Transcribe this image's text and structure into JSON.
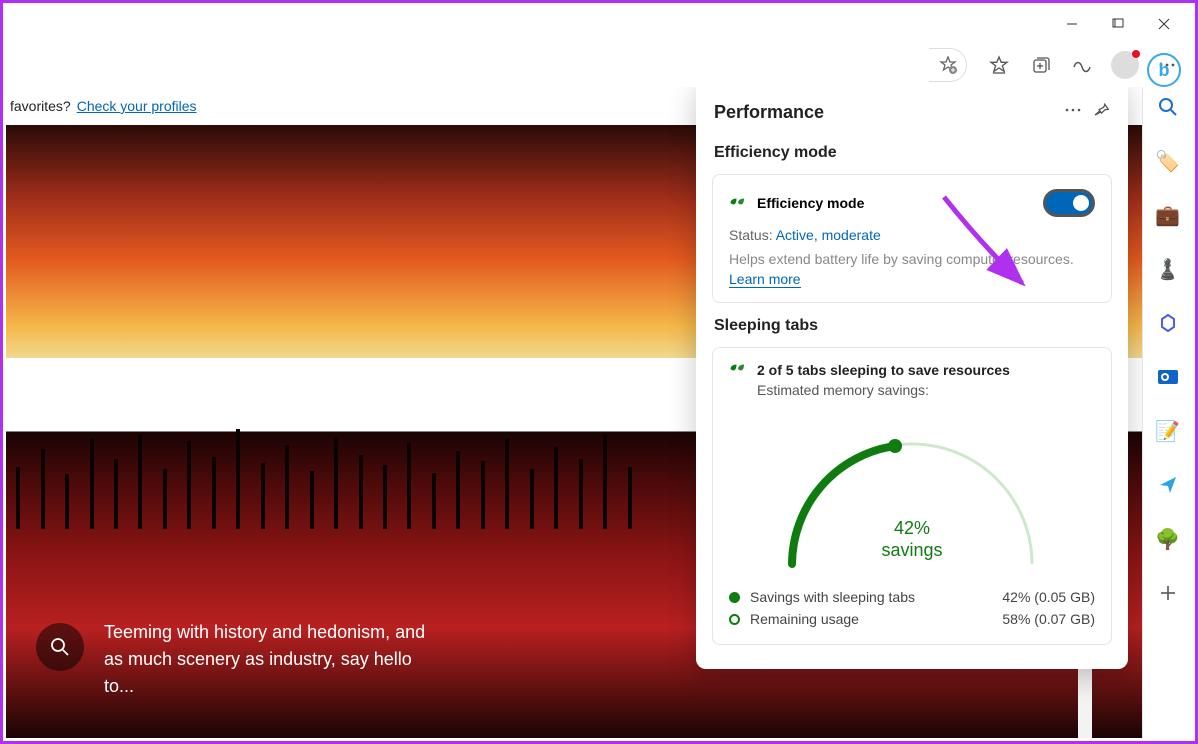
{
  "favbar": {
    "prompt": "favorites?",
    "link": "Check your profiles"
  },
  "hero": {
    "caption": "Teeming with history and hedonism, and as much scenery as industry, say hello to..."
  },
  "panel": {
    "title": "Performance",
    "efficiency": {
      "section": "Efficiency mode",
      "label": "Efficiency mode",
      "status_prefix": "Status: ",
      "status_value": "Active, moderate",
      "help": "Helps extend battery life by saving computer resources.",
      "learn_more": "Learn more"
    },
    "sleeping": {
      "section": "Sleeping tabs",
      "headline": "2 of 5 tabs sleeping to save resources",
      "subline": "Estimated memory savings:",
      "pct_line1": "42%",
      "pct_line2": "savings",
      "legend": [
        {
          "label": "Savings with sleeping tabs",
          "value": "42% (0.05 GB)"
        },
        {
          "label": "Remaining usage",
          "value": "58% (0.07 GB)"
        }
      ]
    }
  }
}
